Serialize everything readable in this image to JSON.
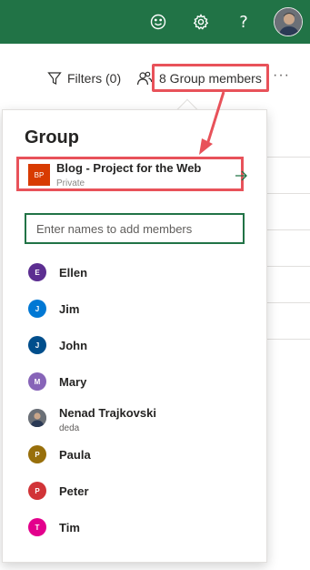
{
  "topbar": {
    "icons": [
      "smiley-icon",
      "gear-icon",
      "help-icon"
    ],
    "help_glyph": "?"
  },
  "commandbar": {
    "filters_label": "Filters (0)",
    "group_members_label": "8 Group members",
    "more_label": "···"
  },
  "panel": {
    "title": "Group",
    "group": {
      "logo_text": "BP",
      "name": "Blog - Project for the Web",
      "visibility": "Private"
    },
    "add_input_placeholder": "Enter names to add members",
    "members": [
      {
        "initial": "E",
        "name": "Ellen",
        "color": "#5c2e91"
      },
      {
        "initial": "J",
        "name": "Jim",
        "color": "#0078d4"
      },
      {
        "initial": "J",
        "name": "John",
        "color": "#004e8c"
      },
      {
        "initial": "M",
        "name": "Mary",
        "color": "#8764b8"
      },
      {
        "initial": "",
        "name": "Nenad Trajkovski",
        "subtitle": "deda",
        "color": "#5b6168"
      },
      {
        "initial": "P",
        "name": "Paula",
        "color": "#986f0b"
      },
      {
        "initial": "P",
        "name": "Peter",
        "color": "#d13438"
      },
      {
        "initial": "T",
        "name": "Tim",
        "color": "#e3008c"
      }
    ]
  },
  "colors": {
    "brand": "#217346",
    "highlight": "#e8525a"
  }
}
